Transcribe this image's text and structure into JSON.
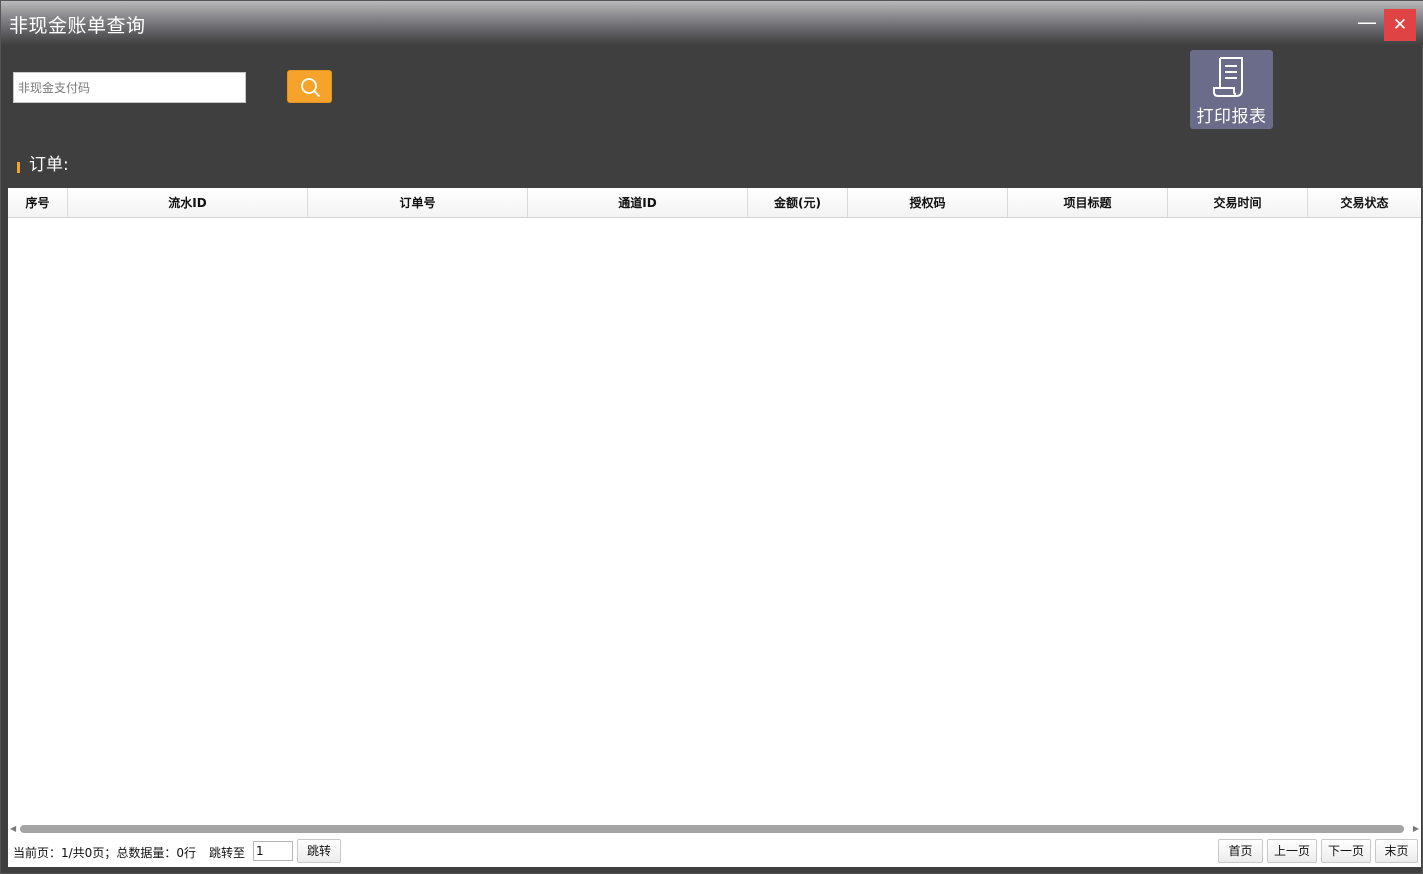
{
  "window": {
    "title": "非现金账单查询",
    "minimize_label": "—",
    "close_label": "✕"
  },
  "toolbar": {
    "search_placeholder": "非现金支付码",
    "search_value": "",
    "print_label": "打印报表",
    "accent_color": "#f5a32a",
    "print_button_color": "#6b6c8a"
  },
  "section": {
    "title": "订单:"
  },
  "grid": {
    "columns": [
      "序号",
      "流水ID",
      "订单号",
      "通道ID",
      "金额(元)",
      "授权码",
      "项目标题",
      "交易时间",
      "交易状态"
    ],
    "rows": []
  },
  "pager": {
    "status": "当前页：1/共0页；总数据量：0行",
    "jump_label": "跳转至",
    "jump_value": "1",
    "jump_button": "跳转",
    "first": "首页",
    "prev": "上一页",
    "next": "下一页",
    "last": "末页"
  }
}
